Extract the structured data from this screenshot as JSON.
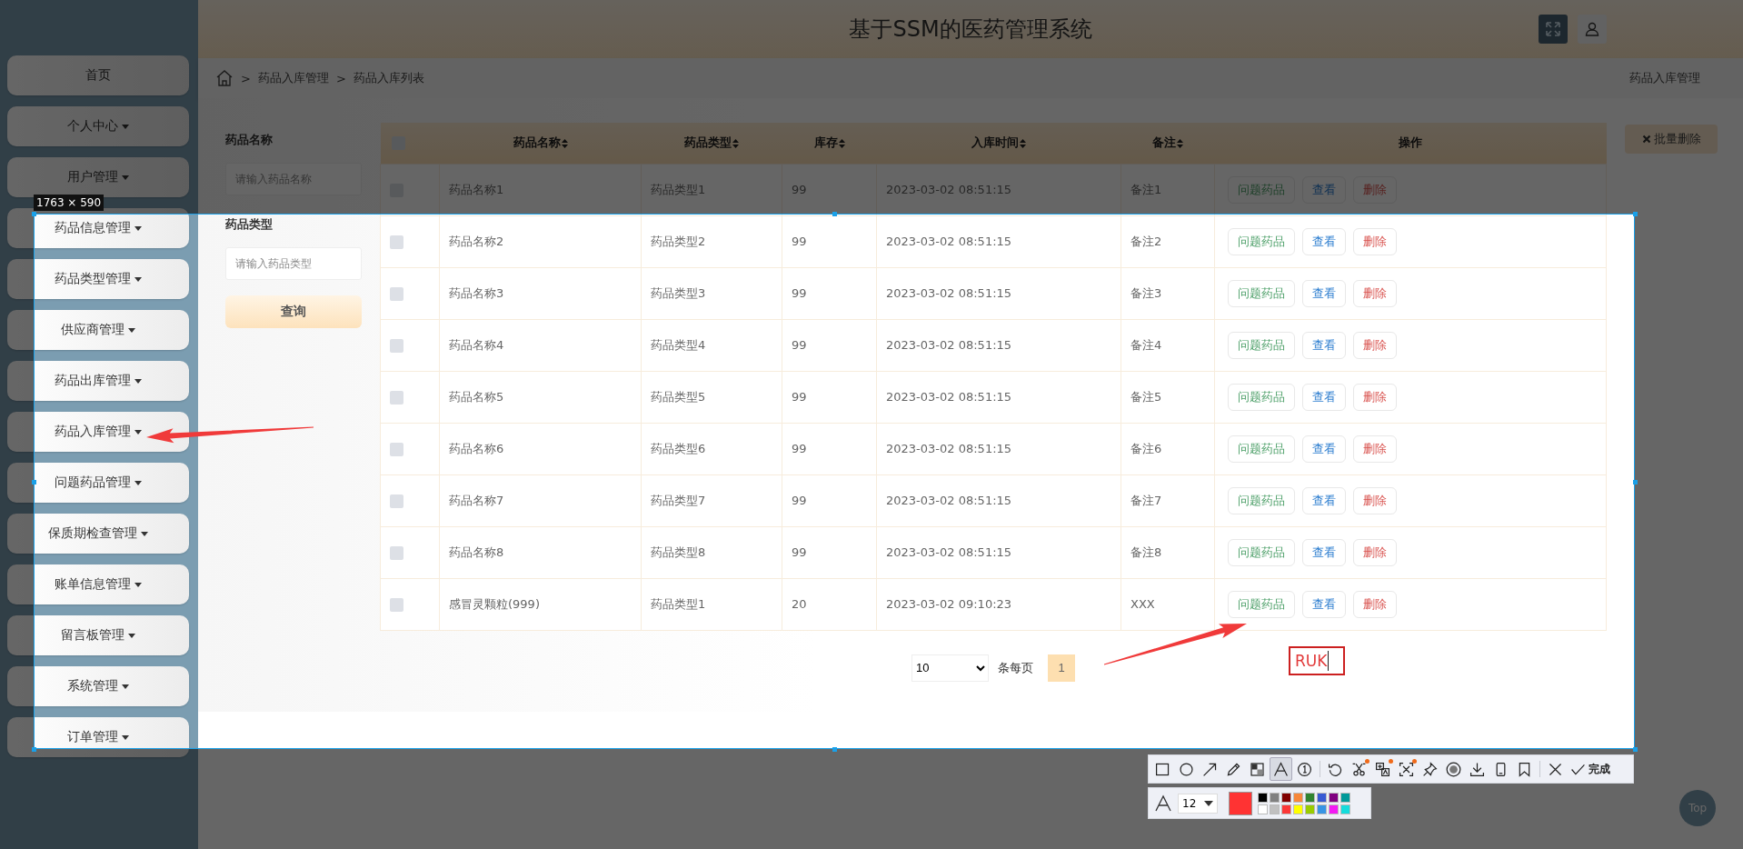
{
  "header": {
    "title": "基于SSM的医药管理系统",
    "buttons": [
      {
        "kind": "fullscreen"
      },
      {
        "kind": "user"
      }
    ]
  },
  "sidebar": {
    "items": [
      {
        "label": "首页",
        "has_menu": false
      },
      {
        "label": "个人中心",
        "has_menu": true
      },
      {
        "label": "用户管理",
        "has_menu": true
      },
      {
        "label": "药品信息管理",
        "has_menu": true
      },
      {
        "label": "药品类型管理",
        "has_menu": true
      },
      {
        "label": "供应商管理",
        "has_menu": true
      },
      {
        "label": "药品出库管理",
        "has_menu": true
      },
      {
        "label": "药品入库管理",
        "has_menu": true
      },
      {
        "label": "问题药品管理",
        "has_menu": true
      },
      {
        "label": "保质期检查管理",
        "has_menu": true
      },
      {
        "label": "账单信息管理",
        "has_menu": true
      },
      {
        "label": "留言板管理",
        "has_menu": true
      },
      {
        "label": "系统管理",
        "has_menu": true
      },
      {
        "label": "订单管理",
        "has_menu": true
      }
    ]
  },
  "breadcrumb": {
    "items": [
      {
        "separator": ">",
        "label": "药品入库管理"
      },
      {
        "separator": ">",
        "label": "药品入库列表"
      }
    ],
    "page_title": "药品入库管理"
  },
  "search": {
    "fields": [
      {
        "label": "药品名称",
        "placeholder": "请输入药品名称"
      },
      {
        "label": "药品类型",
        "placeholder": "请输入药品类型"
      }
    ],
    "button": "查询"
  },
  "batch_delete": {
    "label": "批量删除"
  },
  "table": {
    "header_checked": false,
    "columns": [
      {
        "label": "药品名称",
        "sortable": true
      },
      {
        "label": "药品类型",
        "sortable": true
      },
      {
        "label": "库存",
        "sortable": true
      },
      {
        "label": "入库时间",
        "sortable": true
      },
      {
        "label": "备注",
        "sortable": true
      },
      {
        "label": "操作",
        "sortable": false
      }
    ],
    "rows": [
      {
        "checked": false,
        "cells": [
          "药品名称1",
          "药品类型1",
          "99",
          "2023-03-02 08:51:15",
          "备注1"
        ],
        "actions": [
          {
            "label": "问题药品",
            "kind": "issue"
          },
          {
            "label": "查看",
            "kind": "view"
          },
          {
            "label": "删除",
            "kind": "delete"
          }
        ]
      },
      {
        "checked": false,
        "cells": [
          "药品名称2",
          "药品类型2",
          "99",
          "2023-03-02 08:51:15",
          "备注2"
        ],
        "actions": [
          {
            "label": "问题药品",
            "kind": "issue"
          },
          {
            "label": "查看",
            "kind": "view"
          },
          {
            "label": "删除",
            "kind": "delete"
          }
        ]
      },
      {
        "checked": false,
        "cells": [
          "药品名称3",
          "药品类型3",
          "99",
          "2023-03-02 08:51:15",
          "备注3"
        ],
        "actions": [
          {
            "label": "问题药品",
            "kind": "issue"
          },
          {
            "label": "查看",
            "kind": "view"
          },
          {
            "label": "删除",
            "kind": "delete"
          }
        ]
      },
      {
        "checked": false,
        "cells": [
          "药品名称4",
          "药品类型4",
          "99",
          "2023-03-02 08:51:15",
          "备注4"
        ],
        "actions": [
          {
            "label": "问题药品",
            "kind": "issue"
          },
          {
            "label": "查看",
            "kind": "view"
          },
          {
            "label": "删除",
            "kind": "delete"
          }
        ]
      },
      {
        "checked": false,
        "cells": [
          "药品名称5",
          "药品类型5",
          "99",
          "2023-03-02 08:51:15",
          "备注5"
        ],
        "actions": [
          {
            "label": "问题药品",
            "kind": "issue"
          },
          {
            "label": "查看",
            "kind": "view"
          },
          {
            "label": "删除",
            "kind": "delete"
          }
        ]
      },
      {
        "checked": false,
        "cells": [
          "药品名称6",
          "药品类型6",
          "99",
          "2023-03-02 08:51:15",
          "备注6"
        ],
        "actions": [
          {
            "label": "问题药品",
            "kind": "issue"
          },
          {
            "label": "查看",
            "kind": "view"
          },
          {
            "label": "删除",
            "kind": "delete"
          }
        ]
      },
      {
        "checked": false,
        "cells": [
          "药品名称7",
          "药品类型7",
          "99",
          "2023-03-02 08:51:15",
          "备注7"
        ],
        "actions": [
          {
            "label": "问题药品",
            "kind": "issue"
          },
          {
            "label": "查看",
            "kind": "view"
          },
          {
            "label": "删除",
            "kind": "delete"
          }
        ]
      },
      {
        "checked": false,
        "cells": [
          "药品名称8",
          "药品类型8",
          "99",
          "2023-03-02 08:51:15",
          "备注8"
        ],
        "actions": [
          {
            "label": "问题药品",
            "kind": "issue"
          },
          {
            "label": "查看",
            "kind": "view"
          },
          {
            "label": "删除",
            "kind": "delete"
          }
        ]
      },
      {
        "checked": false,
        "cells": [
          "感冒灵颗粒(999)",
          "药品类型1",
          "20",
          "2023-03-02 09:10:23",
          "XXX"
        ],
        "actions": [
          {
            "label": "问题药品",
            "kind": "issue"
          },
          {
            "label": "查看",
            "kind": "view"
          },
          {
            "label": "删除",
            "kind": "delete"
          }
        ]
      }
    ]
  },
  "pagination": {
    "page_size": "10",
    "per_page_label": "条每页",
    "pages": [
      {
        "label": "1",
        "selected": true
      }
    ]
  },
  "back_to_top": {
    "label": "Top"
  },
  "capture": {
    "size_label": "1763 × 590",
    "annotation": {
      "text": "RUK"
    },
    "tool_groups": [
      [
        {
          "kind": "rectangle",
          "selected": false,
          "badge": false
        },
        {
          "kind": "ellipse",
          "selected": false,
          "badge": false
        },
        {
          "kind": "arrow",
          "selected": false,
          "badge": false
        },
        {
          "kind": "pencil",
          "selected": false,
          "badge": false
        },
        {
          "kind": "mosaic",
          "selected": false,
          "badge": false
        },
        {
          "kind": "text",
          "selected": true,
          "badge": false
        },
        {
          "kind": "number",
          "selected": false,
          "badge": false
        }
      ],
      [
        {
          "kind": "undo",
          "selected": false,
          "badge": false
        },
        {
          "kind": "scissors",
          "selected": false,
          "badge": true
        },
        {
          "kind": "translate",
          "selected": false,
          "badge": true
        },
        {
          "kind": "ocr",
          "selected": false,
          "badge": true
        },
        {
          "kind": "pin",
          "selected": false,
          "badge": false
        },
        {
          "kind": "record",
          "selected": false,
          "badge": false
        },
        {
          "kind": "download",
          "selected": false,
          "badge": false
        },
        {
          "kind": "phone",
          "selected": false,
          "badge": false
        },
        {
          "kind": "bookmark",
          "selected": false,
          "badge": false
        }
      ],
      [
        {
          "kind": "close",
          "selected": false,
          "badge": false
        },
        {
          "kind": "done",
          "selected": false,
          "badge": false,
          "label": "完成"
        }
      ]
    ],
    "font_size": "12",
    "current_swatch": {
      "color": "#ff3333"
    },
    "palette": [
      {
        "color": "#000000"
      },
      {
        "color": "#808080"
      },
      {
        "color": "#800000"
      },
      {
        "color": "#f7883a"
      },
      {
        "color": "#308430"
      },
      {
        "color": "#385ad3"
      },
      {
        "color": "#800080"
      },
      {
        "color": "#009999"
      },
      {
        "color": "#ffffff"
      },
      {
        "color": "#c0c0c0"
      },
      {
        "color": "#fb3838"
      },
      {
        "color": "#ffff00"
      },
      {
        "color": "#99cc00"
      },
      {
        "color": "#3894e4"
      },
      {
        "color": "#f31bf3"
      },
      {
        "color": "#16dcdc"
      }
    ]
  }
}
